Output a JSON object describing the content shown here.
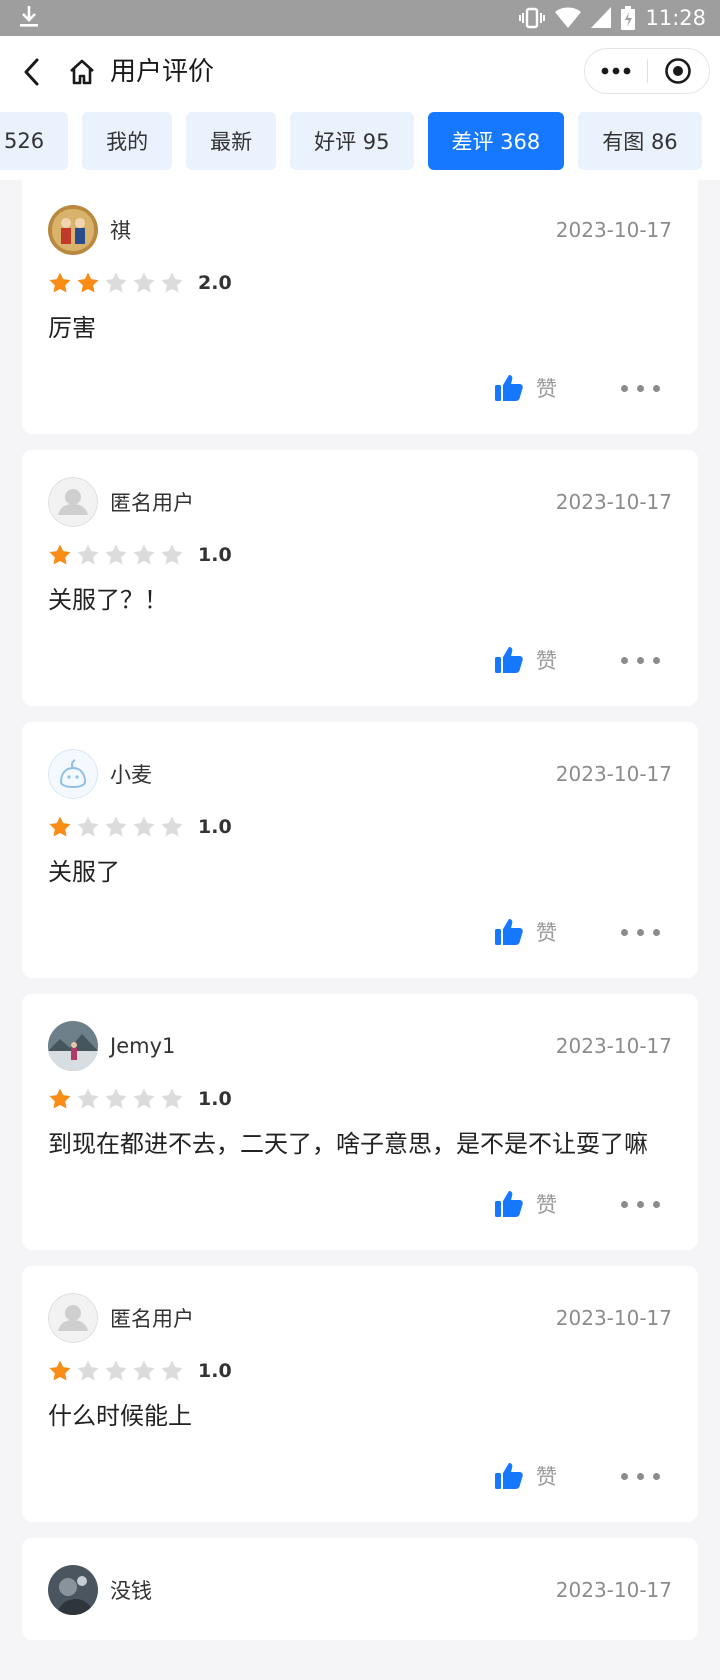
{
  "status_bar": {
    "time": "11:28"
  },
  "nav": {
    "title": "用户评价"
  },
  "tabs": [
    {
      "label": "526"
    },
    {
      "label": "我的"
    },
    {
      "label": "最新"
    },
    {
      "label": "好评 95"
    },
    {
      "label": "差评 368",
      "active": true
    },
    {
      "label": "有图 86"
    }
  ],
  "like_label": "赞",
  "colors": {
    "accent": "#1677ff",
    "star": "#fa8c16",
    "star_empty": "#dcdcdc"
  },
  "reviews": [
    {
      "user": "祺",
      "avatar": "photo-avatar",
      "date": "2023-10-17",
      "rating": 2,
      "score": "2.0",
      "content": "厉害"
    },
    {
      "user": "匿名用户",
      "avatar": "default-user-avatar",
      "date": "2023-10-17",
      "rating": 1,
      "score": "1.0",
      "content": "关服了？！"
    },
    {
      "user": "小麦",
      "avatar": "cartoon-avatar",
      "date": "2023-10-17",
      "rating": 1,
      "score": "1.0",
      "content": "关服了"
    },
    {
      "user": "Jemy1",
      "avatar": "photo-avatar",
      "date": "2023-10-17",
      "rating": 1,
      "score": "1.0",
      "content": "到现在都进不去，二天了，啥子意思，是不是不让耍了嘛"
    },
    {
      "user": "匿名用户",
      "avatar": "default-user-avatar",
      "date": "2023-10-17",
      "rating": 1,
      "score": "1.0",
      "content": "什么时候能上"
    },
    {
      "user": "没钱",
      "avatar": "photo-avatar",
      "date": "2023-10-17"
    }
  ]
}
